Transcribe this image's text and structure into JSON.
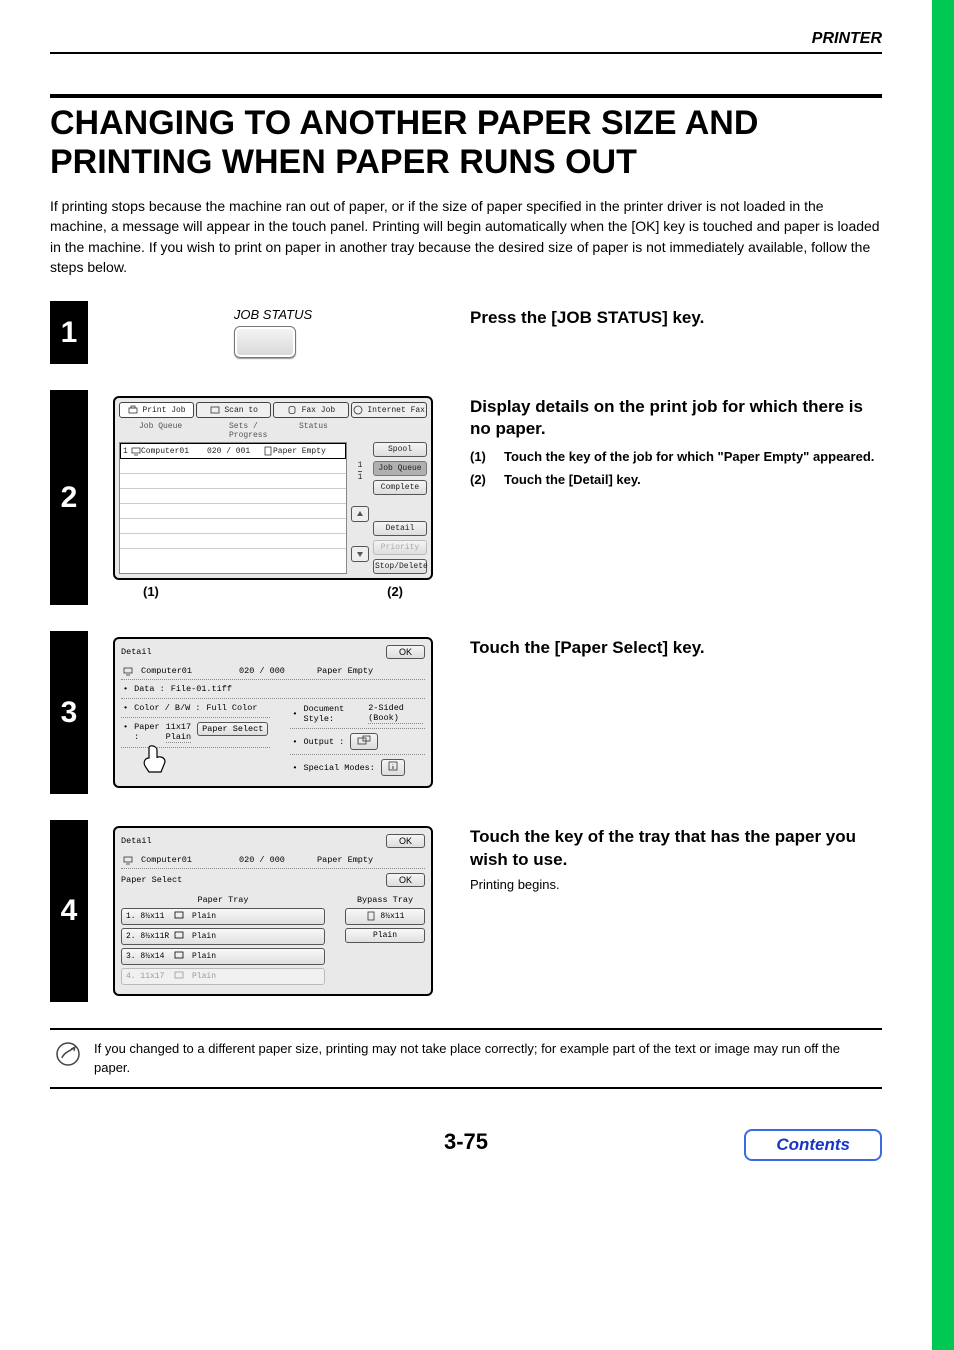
{
  "header": {
    "section_label": "PRINTER"
  },
  "title": "CHANGING TO ANOTHER PAPER SIZE AND PRINTING WHEN PAPER RUNS OUT",
  "intro": "If printing stops because the machine ran out of paper, or if the size of paper specified in the printer driver is not loaded in the machine, a message will appear in the touch panel. Printing will begin automatically when the [OK] key is touched and paper is loaded in the machine. If you wish to print on paper in another tray because the desired size of paper is not immediately available, follow the steps below.",
  "steps": {
    "s1": {
      "number": "1",
      "graphic_label": "JOB STATUS",
      "text": "Press the [JOB STATUS] key."
    },
    "s2": {
      "number": "2",
      "title": "Display details on the print job for which there is no paper.",
      "sub1_num": "(1)",
      "sub1_text": "Touch the key of the job for which \"Paper Empty\" appeared.",
      "sub2_num": "(2)",
      "sub2_text": "Touch the [Detail] key.",
      "callout1": "(1)",
      "callout2": "(2)",
      "panel": {
        "tabs": {
          "print": "Print Job",
          "scan": "Scan to",
          "fax": "Fax Job",
          "ifax": "Internet Fax"
        },
        "headers": {
          "queue": "Job Queue",
          "sets": "Sets / Progress",
          "status": "Status"
        },
        "row": {
          "idx": "1",
          "name": "Computer01",
          "sets": "020 / 001",
          "status": "Paper Empty"
        },
        "side": {
          "spool": "Spool",
          "jobqueue": "Job Queue",
          "complete": "Complete",
          "detail": "Detail",
          "priority": "Priority",
          "stopdel": "Stop/Delete"
        },
        "pager": {
          "top": "1",
          "bottom": "1"
        }
      }
    },
    "s3": {
      "number": "3",
      "title": "Touch the [Paper Select] key.",
      "panel": {
        "title": "Detail",
        "ok": "OK",
        "job": "Computer01",
        "sets": "020 / 000",
        "status": "Paper Empty",
        "data_label": "Data :",
        "data_value": "File-01.tiff",
        "color_label": "Color / B/W :",
        "color_value": "Full Color",
        "docstyle_label": "Document Style:",
        "docstyle_value": "2-Sided (Book)",
        "paper_label": "Paper :",
        "paper_value": "11x17\nPlain",
        "paper_select_btn": "Paper Select",
        "output_label": "Output :",
        "special_label": "Special Modes:"
      }
    },
    "s4": {
      "number": "4",
      "title": "Touch the key of the tray that has the paper you wish to use.",
      "followup": "Printing begins.",
      "panel": {
        "title": "Detail",
        "ok": "OK",
        "job": "Computer01",
        "sets": "020 / 000",
        "status": "Paper Empty",
        "ps_title": "Paper Select",
        "ps_ok": "OK",
        "paper_tray_head": "Paper Tray",
        "bypass_head": "Bypass Tray",
        "trays": [
          {
            "label": "1.",
            "size": "8½x11",
            "type": "Plain",
            "ghost": false
          },
          {
            "label": "2.",
            "size": "8½x11R",
            "type": "Plain",
            "ghost": false
          },
          {
            "label": "3.",
            "size": "8½x14",
            "type": "Plain",
            "ghost": false
          },
          {
            "label": "4.",
            "size": "11x17",
            "type": "Plain",
            "ghost": true
          }
        ],
        "bypass": {
          "size": "8½x11",
          "type": "Plain"
        }
      }
    }
  },
  "note": "If you changed to a different paper size, printing may not take place correctly; for example part of the text or image may run off the paper.",
  "footer": {
    "page_number": "3-75",
    "contents": "Contents"
  }
}
